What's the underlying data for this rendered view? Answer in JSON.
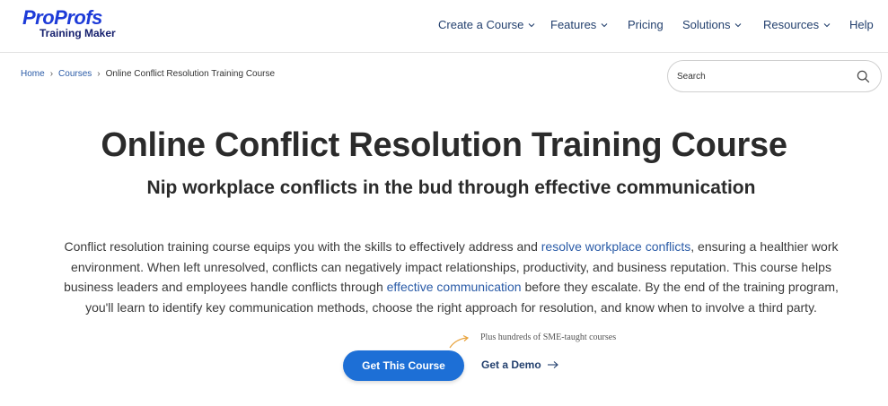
{
  "brand": {
    "name": "ProProfs",
    "product": "Training Maker",
    "color": "#1d3bd8"
  },
  "nav": {
    "items": [
      {
        "label": "Create a Course",
        "dropdown": true
      },
      {
        "label": "Features",
        "dropdown": true
      },
      {
        "label": "Pricing",
        "dropdown": false
      },
      {
        "label": "Solutions",
        "dropdown": true
      },
      {
        "label": "Resources",
        "dropdown": true
      },
      {
        "label": "Help",
        "dropdown": false
      }
    ]
  },
  "breadcrumb": {
    "home": "Home",
    "courses": "Courses",
    "current": "Online Conflict Resolution Training Course",
    "separator": "›"
  },
  "search": {
    "placeholder": "Search",
    "icon": "search-icon"
  },
  "hero": {
    "title": "Online Conflict Resolution Training Course",
    "subtitle": "Nip workplace conflicts in the bud through effective communication"
  },
  "description": {
    "part1": "Conflict resolution training course equips you with the skills to effectively address and ",
    "link1": "resolve workplace conflicts",
    "part2": ", ensuring a healthier work environment. When left unresolved, conflicts can negatively impact relationships, productivity, and business reputation. This course helps business leaders and employees handle conflicts through ",
    "link2": "effective communication",
    "part3": " before they escalate. By the end of the training program, you'll learn to identify key communication methods, choose the right approach for resolution, and know when to involve a third party."
  },
  "cta": {
    "note": "Plus hundreds of SME-taught courses",
    "primary_label": "Get This Course",
    "secondary_label": "Get a Demo",
    "primary_color": "#1d6fd6",
    "accent_arrow_color": "#e8a33d"
  }
}
